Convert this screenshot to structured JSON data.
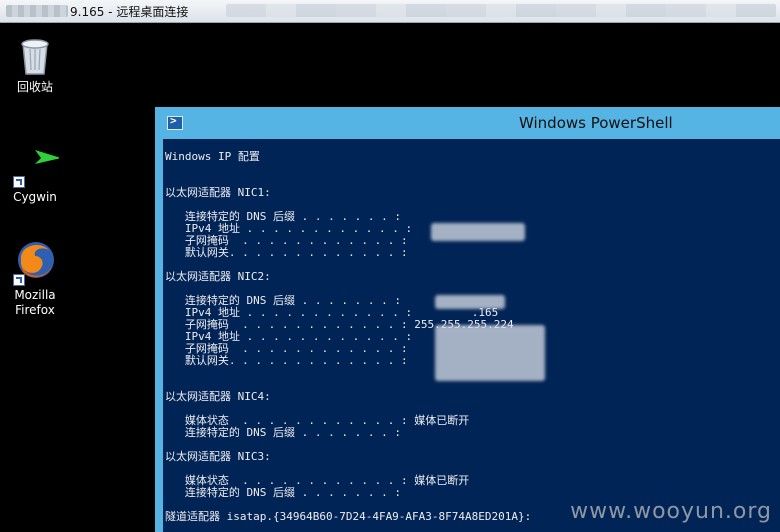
{
  "rdp_bar": {
    "title": "9.165 - 远程桌面连接"
  },
  "desktop": {
    "icons": [
      {
        "label": "回收站"
      },
      {
        "label": "Cygwin"
      },
      {
        "label": "Mozilla Firefox"
      }
    ]
  },
  "powershell": {
    "title": "Windows PowerShell",
    "console": {
      "lines": [
        "Windows IP 配置",
        "",
        "",
        "以太网适配器 NIC1:",
        "",
        "   连接特定的 DNS 后缀 . . . . . . . :",
        "   IPv4 地址 . . . . . . . . . . . . :",
        "   子网掩码  . . . . . . . . . . . . :",
        "   默认网关. . . . . . . . . . . . . :",
        "",
        "以太网适配器 NIC2:",
        "",
        "   连接特定的 DNS 后缀 . . . . . . . :",
        "   IPv4 地址 . . . . . . . . . . . . :         .165",
        "   子网掩码  . . . . . . . . . . . . : 255.255.255.224",
        "   IPv4 地址 . . . . . . . . . . . . :",
        "   子网掩码  . . . . . . . . . . . . :",
        "   默认网关. . . . . . . . . . . . . :",
        "",
        "",
        "以太网适配器 NIC4:",
        "",
        "   媒体状态  . . . . . . . . . . . . : 媒体已断开",
        "   连接特定的 DNS 后缀 . . . . . . . :",
        "",
        "以太网适配器 NIC3:",
        "",
        "   媒体状态  . . . . . . . . . . . . : 媒体已断开",
        "   连接特定的 DNS 后缀 . . . . . . . :",
        "",
        "隧道适配器 isatap.{34964B60-7D24-4FA9-AFA3-8F74A8ED201A}:"
      ]
    }
  },
  "watermark": "www.wooyun.org",
  "colors": {
    "console_bg": "#012456",
    "console_fg": "#eeedf0",
    "window_frame": "#56b4e4",
    "desktop_bg": "#000000"
  }
}
